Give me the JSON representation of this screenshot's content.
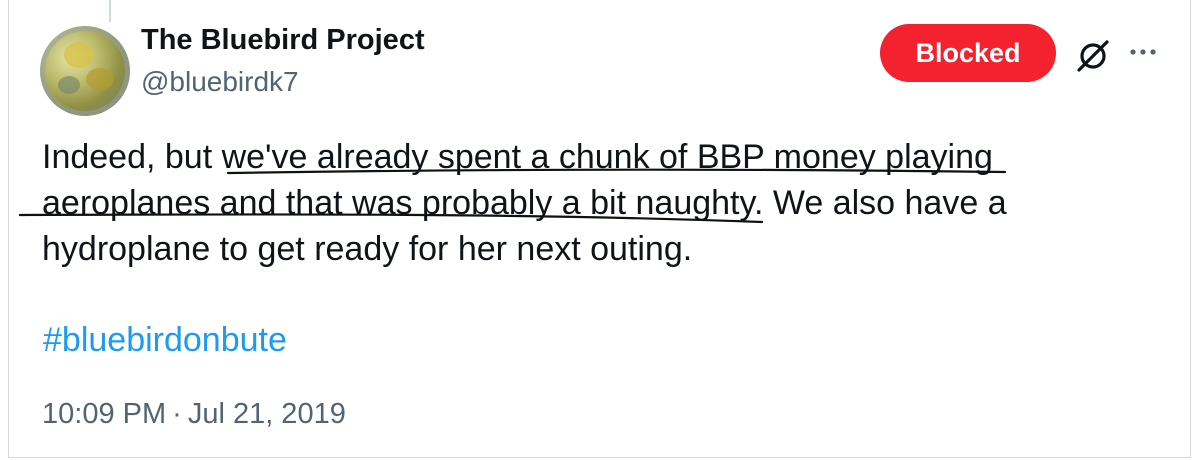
{
  "tweet": {
    "author_name": "The Bluebird Project",
    "author_handle": "@bluebirdk7",
    "blocked_label": "Blocked",
    "text": "Indeed, but we've already spent a chunk of BBP money playing aeroplanes and that was probably a bit naughty. We also have a hydroplane to get ready for her next outing.",
    "hashtag": "#bluebirdonbute",
    "time": "10:09 PM",
    "separator": "·",
    "date": "Jul 21, 2019"
  },
  "icons": {
    "grok": "grok-icon",
    "more": "more-options-icon"
  },
  "colors": {
    "blocked_bg": "#f4212e",
    "link": "#1d9bf0",
    "muted": "#536471",
    "text": "#0f1419"
  }
}
